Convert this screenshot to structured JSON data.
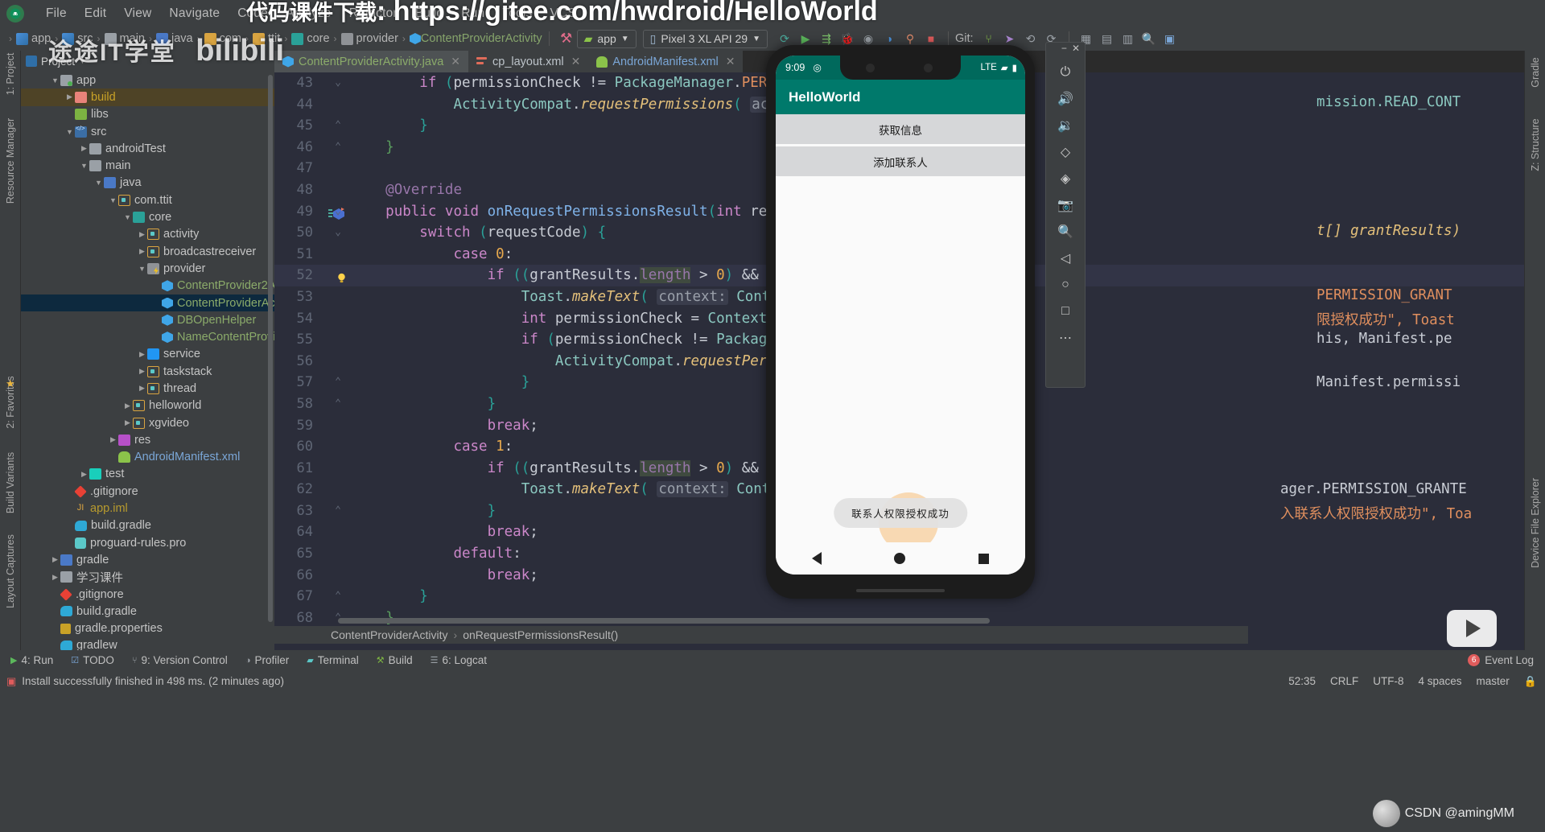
{
  "menu": {
    "logo_icon": "android-studio-logo-icon",
    "items": [
      "File",
      "Edit",
      "View",
      "Navigate",
      "Code",
      "Analyze",
      "Refactor",
      "Build",
      "Run",
      "Tools",
      "VCS"
    ]
  },
  "toolbar": {
    "breadcrumb": [
      {
        "label": "app",
        "icon": "module-icon"
      },
      {
        "label": "src",
        "icon": "source-folder-icon"
      },
      {
        "label": "main",
        "icon": "folder-icon"
      },
      {
        "label": "java",
        "icon": "java-folder-icon"
      },
      {
        "label": "com",
        "icon": "package-icon"
      },
      {
        "label": "ttit",
        "icon": "package-icon"
      },
      {
        "label": "core",
        "icon": "core-folder-icon"
      },
      {
        "label": "provider",
        "icon": "provider-folder-icon"
      },
      {
        "label": "ContentProviderActivity",
        "icon": "java-class-icon"
      }
    ],
    "run_config": "app",
    "device": "Pixel 3 XL API 29",
    "git_label": "Git:",
    "buttons": [
      "sync-icon",
      "avd-manager-icon",
      "sdk-manager-icon",
      "run-icon",
      "debug-icon",
      "profile-icon",
      "attach-debugger-icon",
      "stop-icon",
      "commit-icon",
      "update-icon",
      "push-icon",
      "history-icon",
      "revert-icon",
      "search-icon"
    ]
  },
  "left_strip": {
    "tabs": [
      "1: Project",
      "Resource Manager",
      "2: Favorites",
      "Build Variants",
      "Layout Captures"
    ]
  },
  "right_strip": {
    "tabs": [
      "Gradle",
      "Z: Structure",
      "Device File Explorer"
    ]
  },
  "project": {
    "panel_title": "Project",
    "tree": [
      {
        "indent": 1,
        "arrow": "down",
        "icon": "module-icon",
        "label": "app",
        "color": "default",
        "state": "normal"
      },
      {
        "indent": 2,
        "arrow": "right",
        "icon": "build-folder-icon",
        "label": "build",
        "color": "build",
        "state": "sel-build"
      },
      {
        "indent": 2,
        "arrow": "none",
        "icon": "libs-folder-icon",
        "label": "libs",
        "color": "default",
        "state": "normal"
      },
      {
        "indent": 2,
        "arrow": "down",
        "icon": "source-folder-icon",
        "label": "src",
        "color": "default",
        "state": "normal"
      },
      {
        "indent": 3,
        "arrow": "right",
        "icon": "folder-icon",
        "label": "androidTest",
        "color": "default",
        "state": "normal"
      },
      {
        "indent": 3,
        "arrow": "down",
        "icon": "folder-icon",
        "label": "main",
        "color": "default",
        "state": "normal"
      },
      {
        "indent": 4,
        "arrow": "down",
        "icon": "java-folder-icon",
        "label": "java",
        "color": "default",
        "state": "normal"
      },
      {
        "indent": 5,
        "arrow": "down",
        "icon": "package-icon",
        "label": "com.ttit",
        "color": "default",
        "state": "normal"
      },
      {
        "indent": 6,
        "arrow": "down",
        "icon": "core-folder-icon",
        "label": "core",
        "color": "default",
        "state": "normal"
      },
      {
        "indent": 7,
        "arrow": "right",
        "icon": "package-icon",
        "label": "activity",
        "color": "default",
        "state": "normal"
      },
      {
        "indent": 7,
        "arrow": "right",
        "icon": "package-icon",
        "label": "broadcastreceiver",
        "color": "default",
        "state": "normal"
      },
      {
        "indent": 7,
        "arrow": "down",
        "icon": "provider-folder-icon",
        "label": "provider",
        "color": "default",
        "state": "normal"
      },
      {
        "indent": 8,
        "arrow": "none",
        "icon": "java-class-icon",
        "label": "ContentProvider2Act",
        "color": "green",
        "state": "normal"
      },
      {
        "indent": 8,
        "arrow": "none",
        "icon": "java-class-icon",
        "label": "ContentProviderActiv",
        "color": "green",
        "state": "sel-blue"
      },
      {
        "indent": 8,
        "arrow": "none",
        "icon": "java-class-icon",
        "label": "DBOpenHelper",
        "color": "green",
        "state": "normal"
      },
      {
        "indent": 8,
        "arrow": "none",
        "icon": "java-class-icon",
        "label": "NameContentProvide",
        "color": "green",
        "state": "normal"
      },
      {
        "indent": 7,
        "arrow": "right",
        "icon": "service-folder-icon",
        "label": "service",
        "color": "default",
        "state": "normal"
      },
      {
        "indent": 7,
        "arrow": "right",
        "icon": "package-icon",
        "label": "taskstack",
        "color": "default",
        "state": "normal"
      },
      {
        "indent": 7,
        "arrow": "right",
        "icon": "package-icon",
        "label": "thread",
        "color": "default",
        "state": "normal"
      },
      {
        "indent": 6,
        "arrow": "right",
        "icon": "package-icon",
        "label": "helloworld",
        "color": "default",
        "state": "normal"
      },
      {
        "indent": 6,
        "arrow": "right",
        "icon": "package-icon",
        "label": "xgvideo",
        "color": "default",
        "state": "normal"
      },
      {
        "indent": 5,
        "arrow": "right",
        "icon": "res-folder-icon",
        "label": "res",
        "color": "default",
        "state": "normal"
      },
      {
        "indent": 5,
        "arrow": "none",
        "icon": "android-manifest-icon",
        "label": "AndroidManifest.xml",
        "color": "blue",
        "state": "normal"
      },
      {
        "indent": 3,
        "arrow": "right",
        "icon": "test-folder-icon",
        "label": "test",
        "color": "default",
        "state": "normal"
      },
      {
        "indent": 2,
        "arrow": "none",
        "icon": "gitignore-icon",
        "label": ".gitignore",
        "color": "default",
        "state": "normal"
      },
      {
        "indent": 2,
        "arrow": "none",
        "icon": "iml-icon",
        "label": "app.iml",
        "color": "yellow",
        "state": "normal"
      },
      {
        "indent": 2,
        "arrow": "none",
        "icon": "gradle-icon",
        "label": "build.gradle",
        "color": "default",
        "state": "normal"
      },
      {
        "indent": 2,
        "arrow": "none",
        "icon": "proguard-icon",
        "label": "proguard-rules.pro",
        "color": "default",
        "state": "normal"
      },
      {
        "indent": 1,
        "arrow": "right",
        "icon": "gradle-folder-icon",
        "label": "gradle",
        "color": "default",
        "state": "normal"
      },
      {
        "indent": 1,
        "arrow": "right",
        "icon": "folder-icon",
        "label": "学习课件",
        "color": "default",
        "state": "normal"
      },
      {
        "indent": 1,
        "arrow": "none",
        "icon": "gitignore-icon",
        "label": ".gitignore",
        "color": "default",
        "state": "normal"
      },
      {
        "indent": 1,
        "arrow": "none",
        "icon": "gradle-icon",
        "label": "build.gradle",
        "color": "default",
        "state": "normal"
      },
      {
        "indent": 1,
        "arrow": "none",
        "icon": "properties-icon",
        "label": "gradle.properties",
        "color": "default",
        "state": "normal"
      },
      {
        "indent": 1,
        "arrow": "none",
        "icon": "gradle-icon",
        "label": "gradlew",
        "color": "default",
        "state": "normal"
      }
    ]
  },
  "editor": {
    "tabs": [
      {
        "label": "ContentProviderActivity.java",
        "icon": "java-class-icon",
        "active": true,
        "closable": true
      },
      {
        "label": "cp_layout.xml",
        "icon": "xml-layout-icon",
        "active": false,
        "closable": true
      },
      {
        "label": "AndroidManifest.xml",
        "icon": "android-manifest-icon",
        "active": false,
        "closable": true
      }
    ],
    "first_line": 43,
    "lines": [
      {
        "n": 43,
        "indent": 0,
        "text": "        if (permissionCheck != PackageManager.PER"
      },
      {
        "n": 44,
        "indent": 0,
        "text": "            ActivityCompat.requestPermissions( act"
      },
      {
        "n": 45,
        "indent": 0,
        "text": "        }"
      },
      {
        "n": 46,
        "indent": 0,
        "text": "    }"
      },
      {
        "n": 47,
        "indent": 0,
        "text": ""
      },
      {
        "n": 48,
        "indent": 0,
        "text": "    @Override"
      },
      {
        "n": 49,
        "indent": 0,
        "text": "    public void onRequestPermissionsResult(int re"
      },
      {
        "n": 50,
        "indent": 0,
        "text": "        switch (requestCode) {"
      },
      {
        "n": 51,
        "indent": 0,
        "text": "            case 0:"
      },
      {
        "n": 52,
        "indent": 0,
        "text": "                if ((grantResults.length > 0) &&"
      },
      {
        "n": 53,
        "indent": 0,
        "text": "                    Toast.makeText( context: Content"
      },
      {
        "n": 54,
        "indent": 0,
        "text": "                    int permissionCheck = Context"
      },
      {
        "n": 55,
        "indent": 0,
        "text": "                    if (permissionCheck != Packag"
      },
      {
        "n": 56,
        "indent": 0,
        "text": "                        ActivityCompat.requestPer"
      },
      {
        "n": 57,
        "indent": 0,
        "text": "                    }"
      },
      {
        "n": 58,
        "indent": 0,
        "text": "                }"
      },
      {
        "n": 59,
        "indent": 0,
        "text": "                break;"
      },
      {
        "n": 60,
        "indent": 0,
        "text": "            case 1:"
      },
      {
        "n": 61,
        "indent": 0,
        "text": "                if ((grantResults.length > 0) &&"
      },
      {
        "n": 62,
        "indent": 0,
        "text": "                    Toast.makeText( context: Content"
      },
      {
        "n": 63,
        "indent": 0,
        "text": "                }"
      },
      {
        "n": 64,
        "indent": 0,
        "text": "                break;"
      },
      {
        "n": 65,
        "indent": 0,
        "text": "            default:"
      },
      {
        "n": 66,
        "indent": 0,
        "text": "                break;"
      },
      {
        "n": 67,
        "indent": 0,
        "text": "        }"
      },
      {
        "n": 68,
        "indent": 0,
        "text": "    }"
      }
    ],
    "right_overflow": [
      {
        "n": 43,
        "text": "mission.READ_CONT"
      },
      {
        "n": 49,
        "text": "t[] grantResults)"
      },
      {
        "n": 52,
        "text": "PERMISSION_GRANT"
      },
      {
        "n": 53,
        "text": "限授权成功\", Toast"
      },
      {
        "n": 54,
        "text": "his, Manifest.pe"
      },
      {
        "n": 56,
        "text": "Manifest.permissi"
      },
      {
        "n": 61,
        "text": "ager.PERMISSION_GRANTE"
      },
      {
        "n": 62,
        "text": "入联系人权限授权成功\", Toa"
      }
    ],
    "breadcrumb": [
      "ContentProviderActivity",
      "onRequestPermissionsResult()"
    ]
  },
  "emulator": {
    "window_controls": [
      "minimize-icon",
      "close-icon"
    ],
    "side_buttons": [
      "power-icon",
      "volume-up-icon",
      "volume-down-icon",
      "rotate-left-icon",
      "rotate-right-icon",
      "screenshot-icon",
      "zoom-icon",
      "back-icon",
      "home-icon",
      "overview-icon",
      "more-icon"
    ],
    "status_time": "9:09",
    "status_signal": "LTE",
    "app_title": "HelloWorld",
    "buttons": [
      "获取信息",
      "添加联系人"
    ],
    "toast": "联系人权限授权成功",
    "nav": [
      "back-button",
      "home-button",
      "recents-button"
    ]
  },
  "bottom_bar": {
    "items": [
      {
        "label": "4: Run",
        "icon": "run-icon"
      },
      {
        "label": "TODO",
        "icon": "todo-icon"
      },
      {
        "label": "9: Version Control",
        "icon": "vcs-icon"
      },
      {
        "label": "Profiler",
        "icon": "profiler-icon"
      },
      {
        "label": "Terminal",
        "icon": "terminal-icon"
      },
      {
        "label": "Build",
        "icon": "build-icon"
      },
      {
        "label": "6: Logcat",
        "icon": "logcat-icon"
      }
    ],
    "event_log": "Event Log",
    "event_log_count": "6"
  },
  "status_bar": {
    "message": "Install successfully finished in 498 ms. (2 minutes ago)",
    "caret": "52:35",
    "line_sep": "CRLF",
    "encoding": "UTF-8",
    "indent": "4 spaces",
    "branch": "master"
  },
  "watermarks": {
    "top_cn": "代码课件下载",
    "top_url": ": https://gitee.com/hwdroid/HelloWorld",
    "bilibili_cn": "途途IT学堂",
    "bilibili_en": "bilibili",
    "csdn": "CSDN @amingMM"
  },
  "colors": {
    "ide_chrome": "#3c3f41",
    "editor_bg": "#2b2d3a",
    "accent_green": "#8bab6a",
    "selection_blue": "#0d293e",
    "build_highlight": "#4e4326",
    "appbar_teal": "#00796b",
    "statusbar_teal": "#00695c"
  }
}
